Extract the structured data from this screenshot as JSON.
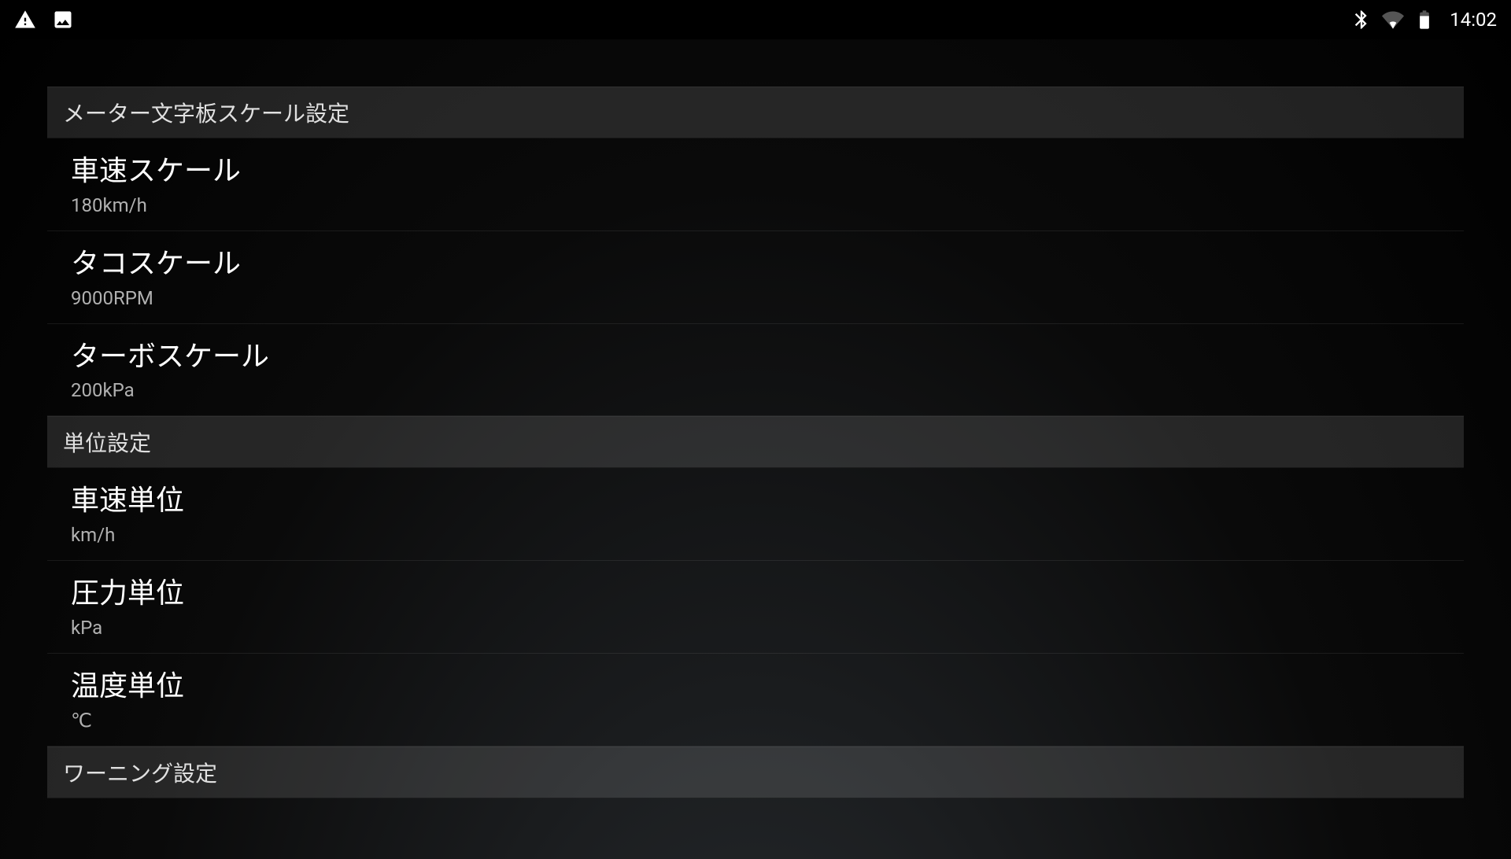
{
  "status_bar": {
    "time": "14:02",
    "icons": {
      "warning": "warning-icon",
      "picture": "picture-icon",
      "bluetooth": "bluetooth-icon",
      "wifi": "wifi-icon",
      "battery": "battery-icon"
    }
  },
  "sections": [
    {
      "header": "メーター文字板スケール設定",
      "items": [
        {
          "title": "車速スケール",
          "value": "180km/h"
        },
        {
          "title": "タコスケール",
          "value": "9000RPM"
        },
        {
          "title": "ターボスケール",
          "value": "200kPa"
        }
      ]
    },
    {
      "header": "単位設定",
      "items": [
        {
          "title": "車速単位",
          "value": "km/h"
        },
        {
          "title": "圧力単位",
          "value": "kPa"
        },
        {
          "title": "温度単位",
          "value": "℃"
        }
      ]
    },
    {
      "header": "ワーニング設定",
      "items": []
    }
  ]
}
